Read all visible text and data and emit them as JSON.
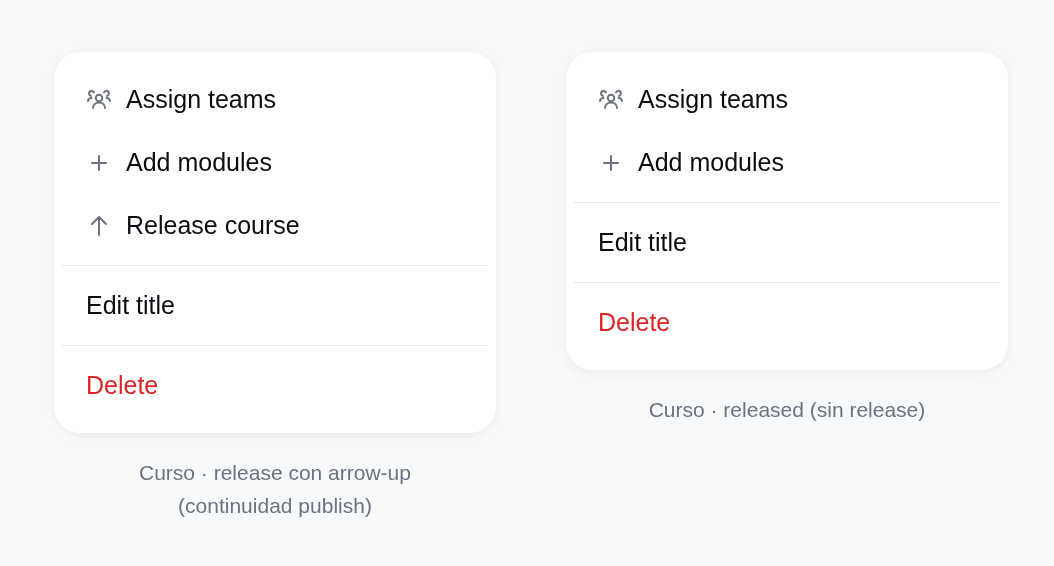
{
  "menus": [
    {
      "sections": [
        [
          {
            "kind": "teams",
            "label": "Assign teams"
          },
          {
            "kind": "add",
            "label": "Add modules"
          },
          {
            "kind": "release",
            "label": "Release course"
          }
        ],
        [
          {
            "kind": "plain",
            "label": "Edit title"
          }
        ],
        [
          {
            "kind": "danger",
            "label": "Delete"
          }
        ]
      ],
      "caption": "Curso · release con arrow-up (continuidad publish)"
    },
    {
      "sections": [
        [
          {
            "kind": "teams",
            "label": "Assign teams"
          },
          {
            "kind": "add",
            "label": "Add modules"
          }
        ],
        [
          {
            "kind": "plain",
            "label": "Edit title"
          }
        ],
        [
          {
            "kind": "danger",
            "label": "Delete"
          }
        ]
      ],
      "caption": "Curso · released (sin release)"
    }
  ]
}
